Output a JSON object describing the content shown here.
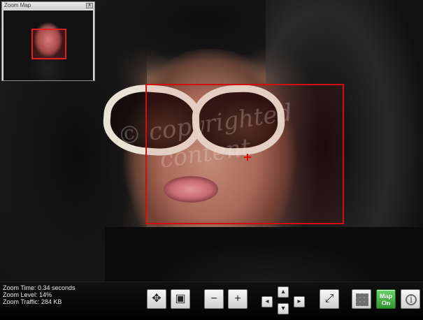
{
  "zoom_map": {
    "title": "Zoom Map",
    "close_label": "x"
  },
  "watermark": {
    "line1": "© copyrighted",
    "line2": "content"
  },
  "status": {
    "zoom_time": "Zoom Time: 0.34 seconds",
    "zoom_level": "Zoom Level: 14%",
    "zoom_traffic": "Zoom Traffic: 284 KB"
  },
  "toolbar": {
    "minus_label": "−",
    "plus_label": "+",
    "pan_left_label": "◂",
    "pan_right_label": "▸",
    "pan_up_label": "▴",
    "pan_down_label": "▾",
    "map_on_line1": "Map",
    "map_on_line2": "On"
  },
  "icons": {
    "move": "move-icon",
    "select": "select-icon",
    "zoom_out": "zoom-out-icon",
    "zoom_in": "zoom-in-icon",
    "pan_left": "pan-left-icon",
    "pan_right": "pan-right-icon",
    "pan_up": "pan-up-icon",
    "pan_down": "pan-down-icon",
    "fit": "fit-to-window-icon",
    "grid": "grid-icon",
    "info": "info-icon"
  },
  "colors": {
    "zoom_rect": "#d10e0e",
    "map_button": "#2f9a2f"
  }
}
